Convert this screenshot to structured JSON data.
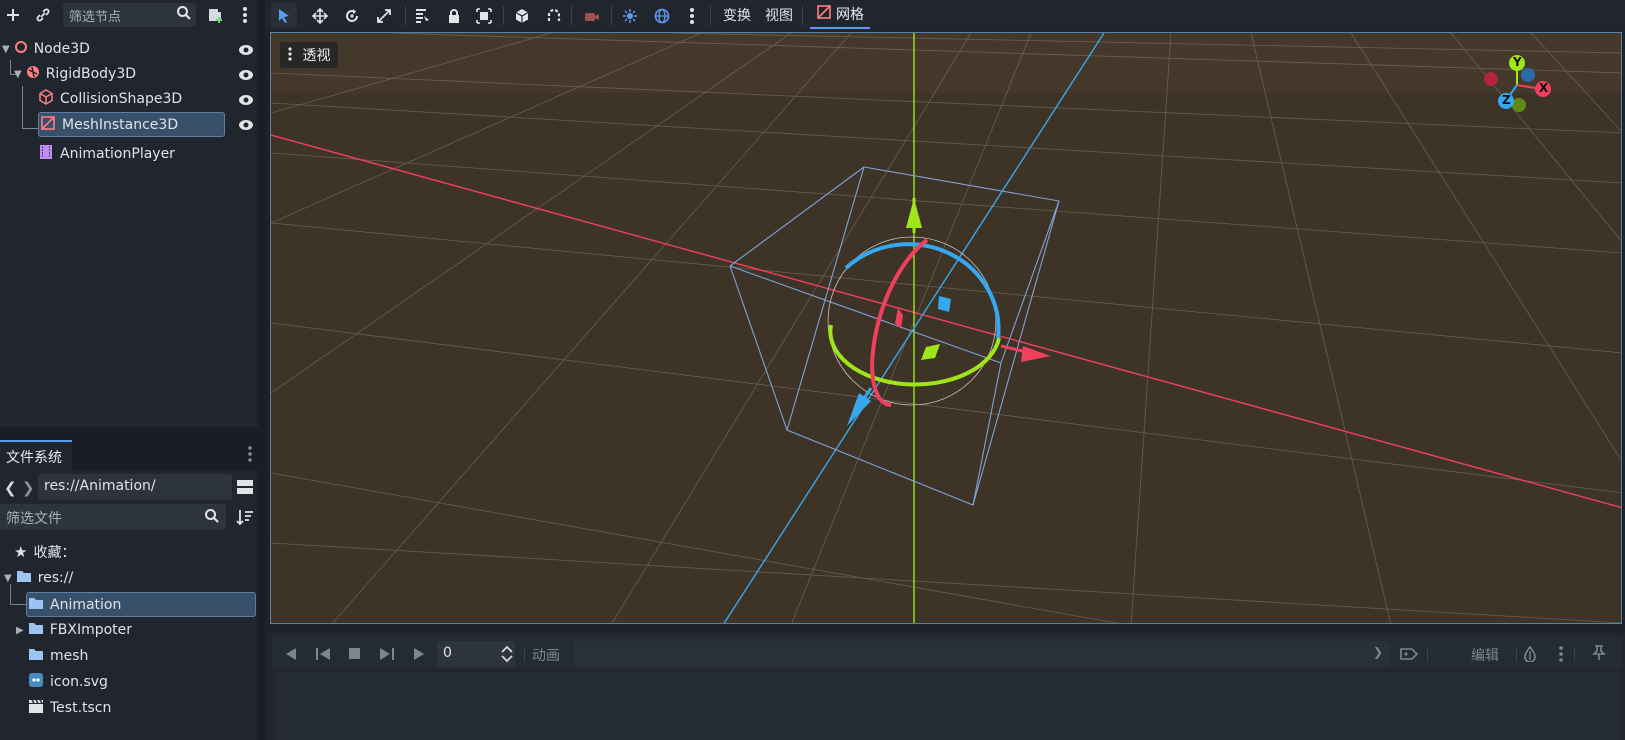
{
  "scene_dock": {
    "node_filter_placeholder": "筛选节点",
    "nodes": [
      {
        "label": "Node3D"
      },
      {
        "label": "RigidBody3D"
      },
      {
        "label": "CollisionShape3D"
      },
      {
        "label": "MeshInstance3D",
        "selected": true
      },
      {
        "label": "AnimationPlayer"
      }
    ]
  },
  "filesystem_dock": {
    "tab_label": "文件系统",
    "path": "res://Animation/",
    "file_filter_placeholder": "筛选文件",
    "favorites_label": "收藏：",
    "items": [
      {
        "label": "res://"
      },
      {
        "label": "Animation",
        "selected": true
      },
      {
        "label": "FBXImpoter"
      },
      {
        "label": "mesh"
      },
      {
        "label": "icon.svg"
      },
      {
        "label": "Test.tscn"
      }
    ]
  },
  "viewport_toolbar": {
    "transform_menu": "变换",
    "view_menu": "视图",
    "mesh_menu": "网格"
  },
  "viewport": {
    "perspective_label": "透视",
    "gizmo": {
      "x": "X",
      "y": "Y",
      "z": "Z"
    },
    "colors": {
      "x_axis": "#f0405e",
      "y_axis": "#9ee619",
      "z_axis": "#36a8f0",
      "ground": "#3e3327"
    }
  },
  "animation_panel": {
    "frame_value": "0",
    "animation_label": "动画",
    "edit_label": "编辑"
  }
}
